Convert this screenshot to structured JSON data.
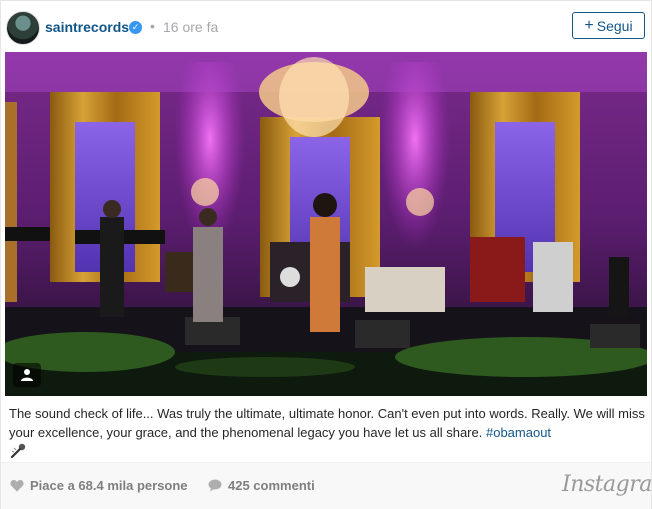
{
  "header": {
    "username": "saintrecords",
    "separator": "•",
    "timestamp": "16 ore fa",
    "follow_label": "Segui"
  },
  "caption": {
    "text": "The sound check of life... Was truly the ultimate, ultimate honor. Can't even put into words. Really. We will miss your excellence, your grace, and the phenomenal legacy you have let us all share.",
    "hashtag": "#obamaout"
  },
  "footer": {
    "likes": "Piace a 68.4 mila persone",
    "comments": "425 commenti",
    "brand": "Instagram"
  },
  "icons": {
    "verified": "verified-badge-icon",
    "follow": "plus-icon",
    "tag": "person-tag-icon",
    "mic": "microphone-emoji-icon",
    "like": "heart-icon",
    "comment": "speech-bubble-icon"
  },
  "colors": {
    "link": "#125688",
    "verified": "#3897f0",
    "muted": "#a5a7aa",
    "stage_light": "#c02bd8"
  }
}
